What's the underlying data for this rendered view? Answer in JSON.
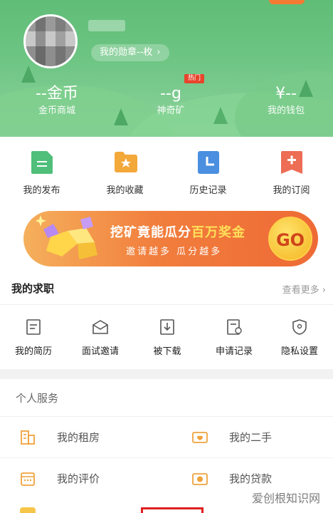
{
  "header": {
    "corner_badge": "",
    "medal_text": "我的勋章--枚",
    "medal_chevron": "›",
    "hot_tag": "热门",
    "stats": [
      {
        "value": "--金币",
        "label": "金币商城"
      },
      {
        "value": "--g",
        "label": "神奇矿"
      },
      {
        "value": "¥--",
        "label": "我的钱包"
      }
    ]
  },
  "quick_actions": [
    {
      "label": "我的发布",
      "icon": "document-icon",
      "color": "#4fbf7a"
    },
    {
      "label": "我的收藏",
      "icon": "star-folder-icon",
      "color": "#f3a83a"
    },
    {
      "label": "历史记录",
      "icon": "clock-icon",
      "color": "#4a8fe0"
    },
    {
      "label": "我的订阅",
      "icon": "plus-bookmark-icon",
      "color": "#ee6d55"
    }
  ],
  "banner": {
    "title_part1": "挖矿竟能瓜分",
    "title_highlight": "百万奖金",
    "subtitle": "邀请越多 瓜分越多",
    "go": "GO"
  },
  "job_section": {
    "title": "我的求职",
    "more": "查看更多",
    "items": [
      {
        "label": "我的简历",
        "icon": "resume-icon"
      },
      {
        "label": "面试邀请",
        "icon": "envelope-icon"
      },
      {
        "label": "被下载",
        "icon": "download-icon"
      },
      {
        "label": "申请记录",
        "icon": "record-icon"
      },
      {
        "label": "隐私设置",
        "icon": "shield-icon"
      }
    ]
  },
  "services": {
    "title": "个人服务",
    "items": [
      {
        "label": "我的租房",
        "icon": "building-icon",
        "color": "#f0a23c"
      },
      {
        "label": "我的二手",
        "icon": "secondhand-icon",
        "color": "#f0a23c"
      },
      {
        "label": "我的评价",
        "icon": "review-icon",
        "color": "#f0a23c"
      },
      {
        "label": "我的贷款",
        "icon": "loan-icon",
        "color": "#f0a23c"
      }
    ]
  },
  "watermark": "爱创根知识网"
}
